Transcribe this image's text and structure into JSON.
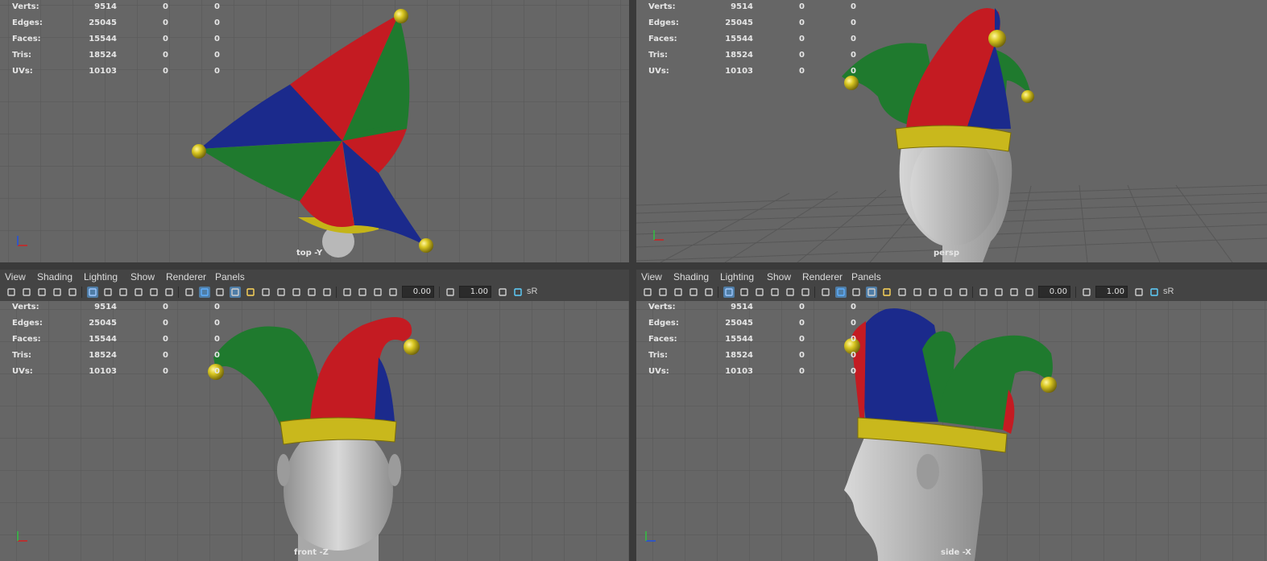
{
  "stats": {
    "rows": [
      {
        "label": "Verts:",
        "v1": "9514",
        "v2": "0",
        "v3": "0"
      },
      {
        "label": "Edges:",
        "v1": "25045",
        "v2": "0",
        "v3": "0"
      },
      {
        "label": "Faces:",
        "v1": "15544",
        "v2": "0",
        "v3": "0"
      },
      {
        "label": "Tris:",
        "v1": "18524",
        "v2": "0",
        "v3": "0"
      },
      {
        "label": "UVs:",
        "v1": "10103",
        "v2": "0",
        "v3": "0"
      }
    ]
  },
  "viewports": {
    "top": {
      "camera": "top -Y"
    },
    "persp": {
      "camera": "persp"
    },
    "front": {
      "camera": "front -Z"
    },
    "side": {
      "camera": "side -X"
    }
  },
  "menu": {
    "view": "View",
    "shading": "Shading",
    "lighting": "Lighting",
    "show": "Show",
    "renderer": "Renderer",
    "panels": "Panels"
  },
  "toolbar": {
    "exposure": "0.00",
    "gamma": "1.00",
    "colorspace": "sR",
    "icons": [
      "camera-icon",
      "camera-lock-icon",
      "bookmark-icon",
      "grease-pencil-icon",
      "image-plane-icon",
      "grid-icon",
      "resolution-gate-icon",
      "field-chart-icon",
      "safe-action-icon",
      "safe-title-icon",
      "film-gate-icon",
      "wireframe-icon",
      "smooth-shade-icon",
      "default-material-icon",
      "textured-icon",
      "all-lights-icon",
      "shadows-icon",
      "ambient-occlusion-icon",
      "motion-blur-icon",
      "anti-alias-icon",
      "depth-of-field-icon",
      "isolate-select-icon",
      "xray-icon",
      "xray-joints-icon",
      "xray-active-icon",
      "exposure-icon",
      "gamma-icon",
      "color-management-icon"
    ]
  },
  "colors": {
    "viewport_bg": "#666666",
    "grid": "#555555",
    "hat_red": "#c41b22",
    "hat_green": "#1f7a2e",
    "hat_blue": "#1b2a8c",
    "hat_gold": "#d4c21a",
    "skin": "#bdbdbd"
  }
}
